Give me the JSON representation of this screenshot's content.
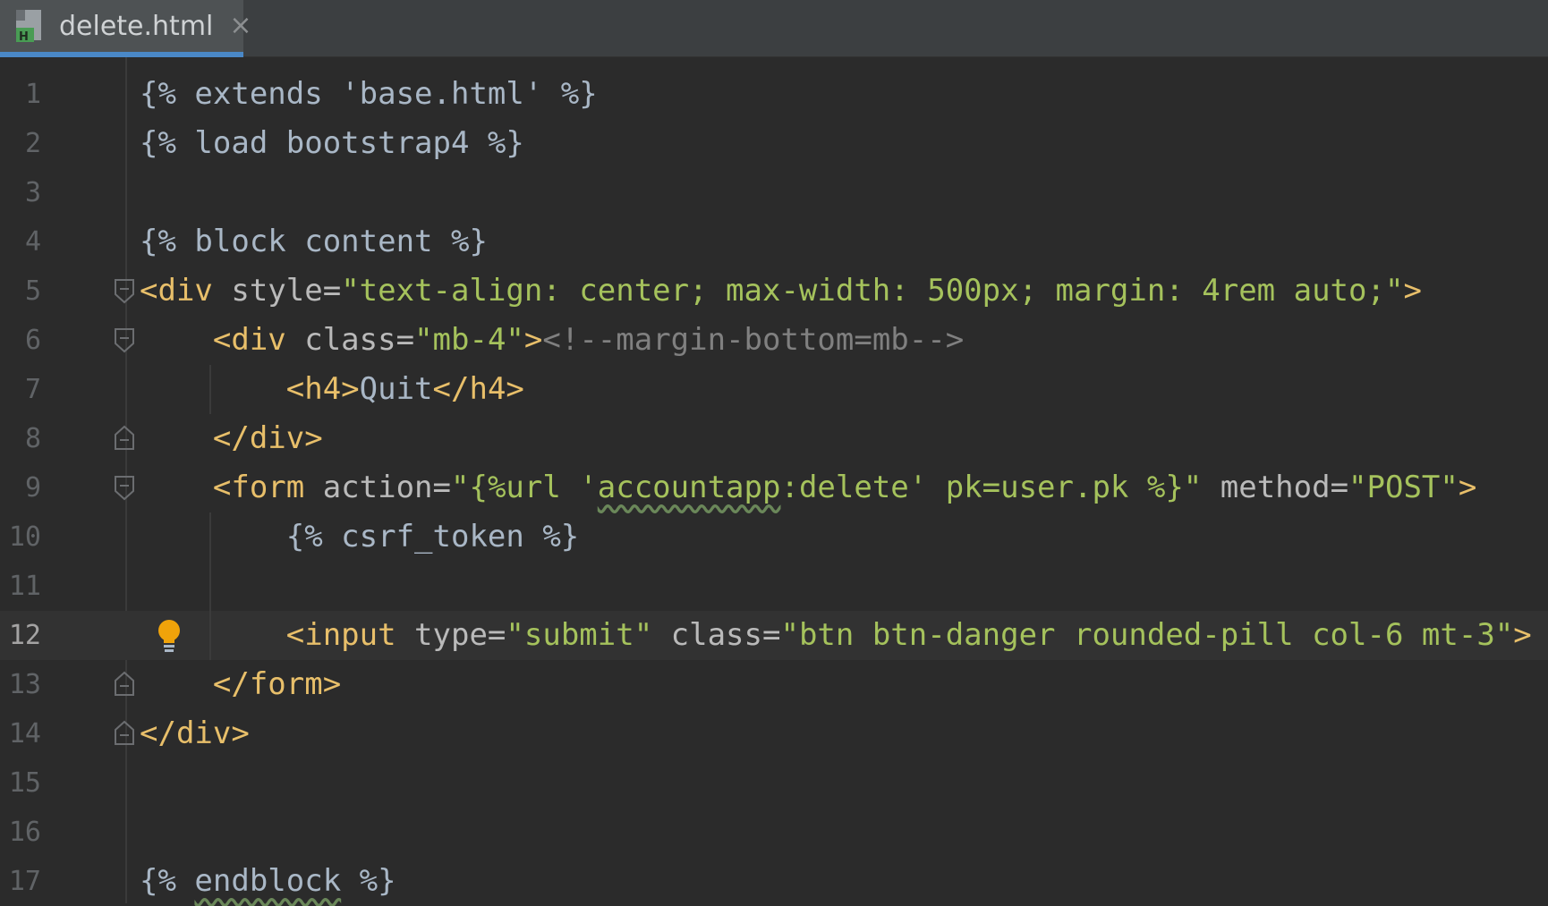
{
  "tab": {
    "title": "delete.html",
    "close_glyph": "×",
    "icon": "html-file-icon"
  },
  "editor": {
    "current_line": 12,
    "lines": [
      {
        "n": "1",
        "segments": [
          {
            "t": "{% extends 'base.html' %}",
            "c": "tpl"
          }
        ]
      },
      {
        "n": "2",
        "segments": [
          {
            "t": "{% load bootstrap4 %}",
            "c": "tpl"
          }
        ]
      },
      {
        "n": "3",
        "segments": []
      },
      {
        "n": "4",
        "segments": [
          {
            "t": "{% block content %}",
            "c": "tpl"
          }
        ]
      },
      {
        "n": "5",
        "segments": [
          {
            "t": "<div",
            "c": "tag"
          },
          {
            "t": " style=",
            "c": "attr"
          },
          {
            "t": "\"text-align: center; max-width: 500px; margin: 4rem auto;\"",
            "c": "str"
          },
          {
            "t": ">",
            "c": "tag"
          }
        ]
      },
      {
        "n": "6",
        "segments": [
          {
            "t": "    <div",
            "c": "tag"
          },
          {
            "t": " class=",
            "c": "attr"
          },
          {
            "t": "\"mb-4\"",
            "c": "str"
          },
          {
            "t": ">",
            "c": "tag"
          },
          {
            "t": "<!--margin-bottom=mb-->",
            "c": "cmt"
          }
        ]
      },
      {
        "n": "7",
        "segments": [
          {
            "t": "        <h4>",
            "c": "tag"
          },
          {
            "t": "Quit",
            "c": "tpl"
          },
          {
            "t": "</h4>",
            "c": "tag"
          }
        ]
      },
      {
        "n": "8",
        "segments": [
          {
            "t": "    </div>",
            "c": "tag"
          }
        ]
      },
      {
        "n": "9",
        "segments": [
          {
            "t": "    <form",
            "c": "tag"
          },
          {
            "t": " action=",
            "c": "attr"
          },
          {
            "t": "\"{%url '",
            "c": "str"
          },
          {
            "t": "accountapp",
            "c": "str wavy"
          },
          {
            "t": ":delete' pk=user.pk %}\"",
            "c": "str"
          },
          {
            "t": " method=",
            "c": "attr"
          },
          {
            "t": "\"POST\"",
            "c": "str"
          },
          {
            "t": ">",
            "c": "tag"
          }
        ]
      },
      {
        "n": "10",
        "segments": [
          {
            "t": "        {% csrf_token %}",
            "c": "tpl"
          }
        ]
      },
      {
        "n": "11",
        "segments": []
      },
      {
        "n": "12",
        "segments": [
          {
            "t": "        <input",
            "c": "tag"
          },
          {
            "t": " type=",
            "c": "attr"
          },
          {
            "t": "\"submit\"",
            "c": "str"
          },
          {
            "t": " class=",
            "c": "attr"
          },
          {
            "t": "\"btn btn-danger rounded-pill col-6 mt-3\"",
            "c": "str"
          },
          {
            "t": ">",
            "c": "tag"
          }
        ]
      },
      {
        "n": "13",
        "segments": [
          {
            "t": "    </form>",
            "c": "tag"
          }
        ]
      },
      {
        "n": "14",
        "segments": [
          {
            "t": "</div>",
            "c": "tag"
          }
        ]
      },
      {
        "n": "15",
        "segments": []
      },
      {
        "n": "16",
        "segments": []
      },
      {
        "n": "17",
        "segments": [
          {
            "t": "{% ",
            "c": "tpl"
          },
          {
            "t": "endblock",
            "c": "tpl wavy"
          },
          {
            "t": " %}",
            "c": "tpl"
          }
        ]
      }
    ]
  },
  "gutter": {
    "fold_markers": [
      {
        "line": 5,
        "kind": "start"
      },
      {
        "line": 6,
        "kind": "start"
      },
      {
        "line": 8,
        "kind": "end"
      },
      {
        "line": 9,
        "kind": "start"
      },
      {
        "line": 13,
        "kind": "end"
      },
      {
        "line": 14,
        "kind": "end"
      }
    ],
    "intention_line": 12,
    "intention_icon": "lightbulb-icon"
  },
  "colors": {
    "background": "#2b2b2b",
    "tag": "#e8bf6a",
    "string": "#a5c25c",
    "text": "#a9b7c6",
    "comment": "#808080",
    "tab_accent": "#4a88c7",
    "bulb": "#f0a30a"
  }
}
